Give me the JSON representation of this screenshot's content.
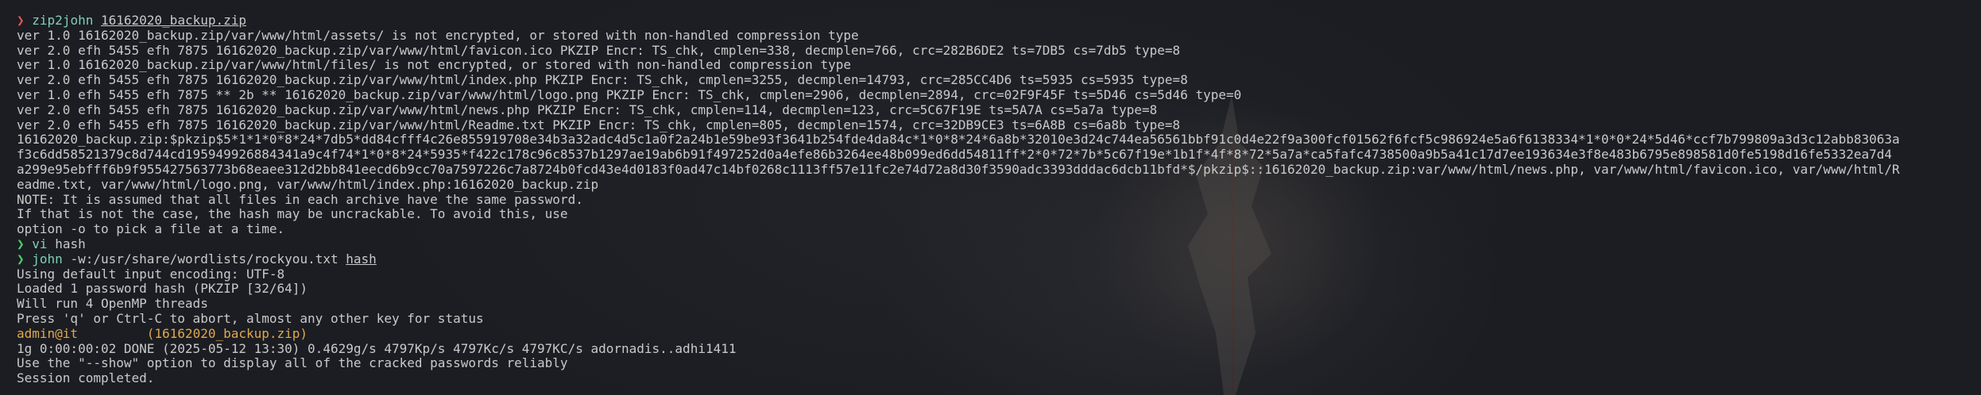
{
  "terminal": {
    "colors": {
      "background": "#1b1d22",
      "text": "#c9c9c9",
      "prompt_error": "#e05757",
      "prompt_ok": "#4fcf6a",
      "command": "#7fd0b4",
      "highlight": "#e0a84e"
    },
    "cmd1": {
      "arrow": "❯",
      "command": "zip2john",
      "argument": "16162020_backup.zip"
    },
    "output1": [
      "ver 1.0 16162020_backup.zip/var/www/html/assets/ is not encrypted, or stored with non-handled compression type",
      "ver 2.0 efh 5455 efh 7875 16162020_backup.zip/var/www/html/favicon.ico PKZIP Encr: TS_chk, cmplen=338, decmplen=766, crc=282B6DE2 ts=7DB5 cs=7db5 type=8",
      "ver 1.0 16162020_backup.zip/var/www/html/files/ is not encrypted, or stored with non-handled compression type",
      "ver 2.0 efh 5455 efh 7875 16162020_backup.zip/var/www/html/index.php PKZIP Encr: TS_chk, cmplen=3255, decmplen=14793, crc=285CC4D6 ts=5935 cs=5935 type=8",
      "ver 1.0 efh 5455 efh 7875 ** 2b ** 16162020_backup.zip/var/www/html/logo.png PKZIP Encr: TS_chk, cmplen=2906, decmplen=2894, crc=02F9F45F ts=5D46 cs=5d46 type=0",
      "ver 2.0 efh 5455 efh 7875 16162020_backup.zip/var/www/html/news.php PKZIP Encr: TS_chk, cmplen=114, decmplen=123, crc=5C67F19E ts=5A7A cs=5a7a type=8",
      "ver 2.0 efh 5455 efh 7875 16162020_backup.zip/var/www/html/Readme.txt PKZIP Encr: TS_chk, cmplen=805, decmplen=1574, crc=32DB9CE3 ts=6A8B cs=6a8b type=8",
      "16162020_backup.zip:$pkzip$5*1*1*0*8*24*7db5*dd84cfff4c26e855919708e34b3a32adc4d5c1a0f2a24b1e59be93f3641b254fde4da84c*1*0*8*24*6a8b*32010e3d24c744ea56561bbf91c0d4e22f9a300fcf01562f6fcf5c986924e5a6f6138334*1*0*0*24*5d46*ccf7b799809a3d3c12abb83063a",
      "f3c6dd58521379c8d744cd195949926884341a9c4f74*1*0*8*24*5935*f422c178c96c8537b1297ae19ab6b91f497252d0a4efe86b3264ee48b099ed6dd54811ff*2*0*72*7b*5c67f19e*1b1f*4f*8*72*5a7a*ca5fafc4738500a9b5a41c17d7ee193634e3f8e483b6795e898581d0fe5198d16fe5332ea7d4",
      "a299e95ebfff6b9f955427563773b68eaee312d2bb841eecd6b9cc70a7597226c7a8724b0fcd43e4d0183f0ad47c14bf0268c1113ff57e11fc2e74d72a8d30f3590adc3393dddac6dcb11bfd*$/pkzip$::16162020_backup.zip:var/www/html/news.php, var/www/html/favicon.ico, var/www/html/R",
      "eadme.txt, var/www/html/logo.png, var/www/html/index.php:16162020_backup.zip",
      "NOTE: It is assumed that all files in each archive have the same password.",
      "If that is not the case, the hash may be uncrackable. To avoid this, use",
      "option -o to pick a file at a time."
    ],
    "cmd2": {
      "arrow": "❯",
      "command": "vi",
      "argument": "hash"
    },
    "cmd3": {
      "arrow": "❯",
      "command": "john",
      "argument": "-w:/usr/share/wordlists/rockyou.txt",
      "argument2": "hash"
    },
    "output3": [
      "Using default input encoding: UTF-8",
      "Loaded 1 password hash (PKZIP [32/64])",
      "Will run 4 OpenMP threads",
      "Press 'q' or Ctrl-C to abort, almost any other key for status"
    ],
    "cracked": {
      "user": "admin@it",
      "file": "(16162020_backup.zip)"
    },
    "output4": [
      "1g 0:00:00:02 DONE (2025-05-12 13:30) 0.4629g/s 4797Kp/s 4797Kc/s 4797KC/s adornadis..adhi1411",
      "Use the \"--show\" option to display all of the cracked passwords reliably",
      "Session completed."
    ]
  }
}
